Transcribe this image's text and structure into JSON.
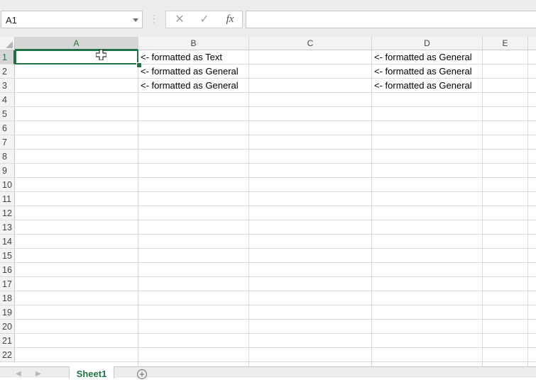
{
  "formula_bar": {
    "name_box": "A1",
    "cancel_icon": "cancel-icon",
    "enter_icon": "checkmark-icon",
    "fx_label": "fx",
    "formula": ""
  },
  "columns": [
    "A",
    "B",
    "C",
    "D",
    "E"
  ],
  "selected_column": "A",
  "rows": [
    "1",
    "2",
    "3",
    "4",
    "5",
    "6",
    "7",
    "8",
    "9",
    "10",
    "11",
    "12",
    "13",
    "14",
    "15",
    "16",
    "17",
    "18",
    "19",
    "20",
    "21",
    "22"
  ],
  "selected_row": "1",
  "cells": {
    "B1": "<- formatted as Text",
    "B2": "<- formatted as General",
    "B3": "<- formatted as General",
    "D1": "<- formatted as General",
    "D2": "<- formatted as General",
    "D3": "<- formatted as General"
  },
  "sheet_tabs": {
    "active": "Sheet1",
    "add_icon": "plus-circle-icon"
  },
  "colors": {
    "accent": "#217346",
    "grid_line": "#dadada",
    "header_bg": "#f3f3f3"
  }
}
